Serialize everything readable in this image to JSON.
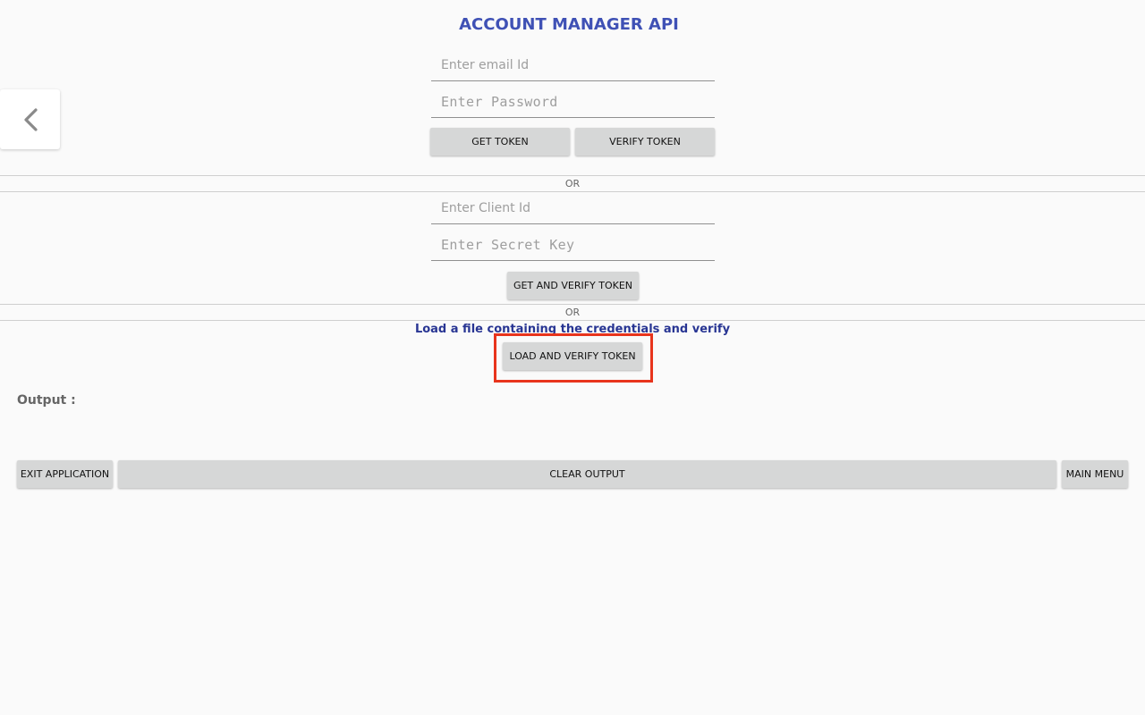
{
  "header": {
    "title": "ACCOUNT MANAGER API"
  },
  "nav": {
    "back_icon": "chevron-left-icon"
  },
  "credentials": {
    "email_placeholder": "Enter email Id",
    "email_value": "",
    "password_placeholder": "Enter Password",
    "password_value": "",
    "get_token_label": "GET TOKEN",
    "verify_token_label": "VERIFY TOKEN"
  },
  "separators": {
    "or_1": "OR",
    "or_2": "OR"
  },
  "client": {
    "client_id_placeholder": "Enter Client Id",
    "client_id_value": "",
    "secret_key_placeholder": "Enter Secret Key",
    "secret_key_value": "",
    "get_and_verify_label": "GET AND VERIFY TOKEN"
  },
  "file_load": {
    "caption": "Load a file containing the credentials and verify",
    "load_and_verify_label": "LOAD AND VERIFY TOKEN",
    "highlight_color": "#e8341c"
  },
  "output": {
    "label": "Output :",
    "text": ""
  },
  "footer": {
    "exit_label": "EXIT APPLICATION",
    "clear_label": "CLEAR OUTPUT",
    "main_menu_label": "MAIN MENU"
  },
  "colors": {
    "accent": "#3f51b5",
    "caption": "#283593",
    "background": "#fafafa",
    "button": "#d6d7d7"
  }
}
